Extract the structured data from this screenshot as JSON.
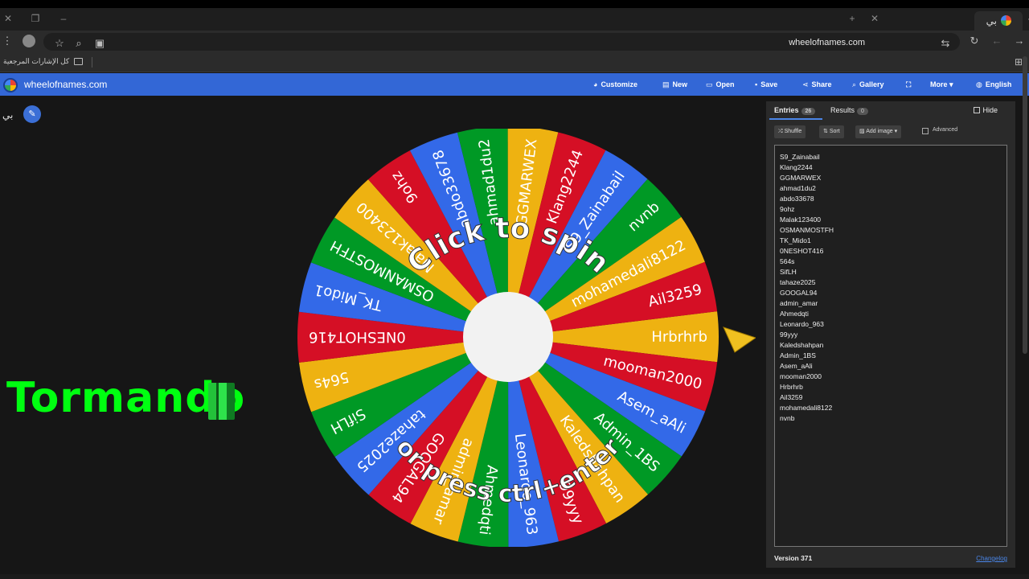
{
  "browser": {
    "tab_title": "بي",
    "url": "wheelofnames.com",
    "bookmark_label": "كل الإشارات المرجعية"
  },
  "app": {
    "site_name": "wheelofnames.com",
    "menu": {
      "customize": "Customize",
      "new": "New",
      "open": "Open",
      "save": "Save",
      "share": "Share",
      "gallery": "Gallery",
      "more": "More",
      "language": "English"
    },
    "wheel_title": "بي"
  },
  "wheel": {
    "top_text": "Click to spin",
    "bottom_text": "or press ctrl+enter",
    "slice_colors": [
      "#eeb211",
      "#d50f25",
      "#3369e8",
      "#009925"
    ],
    "slices": [
      "Hrbrhrb",
      "mooman2000",
      "Asem_aAli",
      "Admin_1BS",
      "Kaledshahpan",
      "99yyy",
      "Leonardo_963",
      "Ahmedqti",
      "admin_amar",
      "GOOGAL94",
      "tahaze2025",
      "SifLH",
      "564s",
      "0NESHOT416",
      "TK_Mido1",
      "OSMANMOSTFH",
      "Malak123400",
      "9ohz",
      "abdo33678",
      "ahmad1du2",
      "GGMARWEX",
      "Klang2244",
      "S9_Zainabail",
      "nvnb",
      "mohamedali8122",
      "Ail3259"
    ]
  },
  "overlay_text": "Tormando",
  "panel": {
    "entries_tab": "Entries",
    "entries_count": "26",
    "results_tab": "Results",
    "results_count": "0",
    "hide_label": "Hide",
    "shuffle": "Shuffle",
    "sort": "Sort",
    "add_image": "Add image",
    "advanced": "Advanced",
    "entries": [
      "S9_Zainabail",
      "Klang2244",
      "GGMARWEX",
      "ahmad1du2",
      "abdo33678",
      "9ohz",
      "Malak123400",
      "OSMANMOSTFH",
      "TK_Mido1",
      "0NESHOT416",
      "564s",
      "SifLH",
      "tahaze2025",
      "GOOGAL94",
      "admin_amar",
      "Ahmedqti",
      "Leonardo_963",
      "99yyy",
      "Kaledshahpan",
      "Admin_1BS",
      "Asem_aAli",
      "mooman2000",
      "Hrbrhrb",
      "Ail3259",
      "mohamedali8122",
      "nvnb"
    ],
    "version": "Version 371",
    "changelog": "Changelog"
  }
}
